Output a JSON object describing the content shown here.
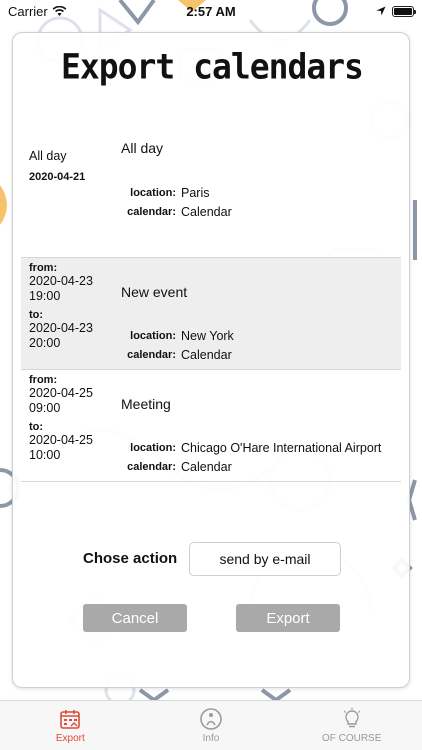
{
  "status_bar": {
    "carrier": "Carrier",
    "time": "2:57 AM"
  },
  "title": "Export calendars",
  "events": [
    {
      "all_day_label": "All day",
      "date": "2020-04-21",
      "title": "All day",
      "location_label": "location:",
      "location": "Paris",
      "calendar_label": "calendar:",
      "calendar": "Calendar"
    },
    {
      "from_label": "from:",
      "from_date": "2020-04-23",
      "from_time": "19:00",
      "to_label": "to:",
      "to_date": "2020-04-23",
      "to_time": "20:00",
      "title": "New event",
      "location_label": "location:",
      "location": "New York",
      "calendar_label": "calendar:",
      "calendar": "Calendar"
    },
    {
      "from_label": "from:",
      "from_date": "2020-04-25",
      "from_time": "09:00",
      "to_label": "to:",
      "to_date": "2020-04-25",
      "to_time": "10:00",
      "title": "Meeting",
      "location_label": "location:",
      "location": "Chicago O'Hare International Airport",
      "calendar_label": "calendar:",
      "calendar": "Calendar"
    }
  ],
  "action": {
    "label": "Chose action",
    "selected": "send by e-mail"
  },
  "buttons": {
    "cancel": "Cancel",
    "export": "Export"
  },
  "tabs": [
    {
      "label": "Export",
      "icon": "calendar-export-icon",
      "active": true
    },
    {
      "label": "Info",
      "icon": "info-icon",
      "active": false
    },
    {
      "label": "OF COURSE",
      "icon": "lightbulb-icon",
      "active": false
    }
  ],
  "colors": {
    "accent": "#e04a3a",
    "button": "#a9a9a9",
    "shaded_row": "#eeeeee"
  }
}
